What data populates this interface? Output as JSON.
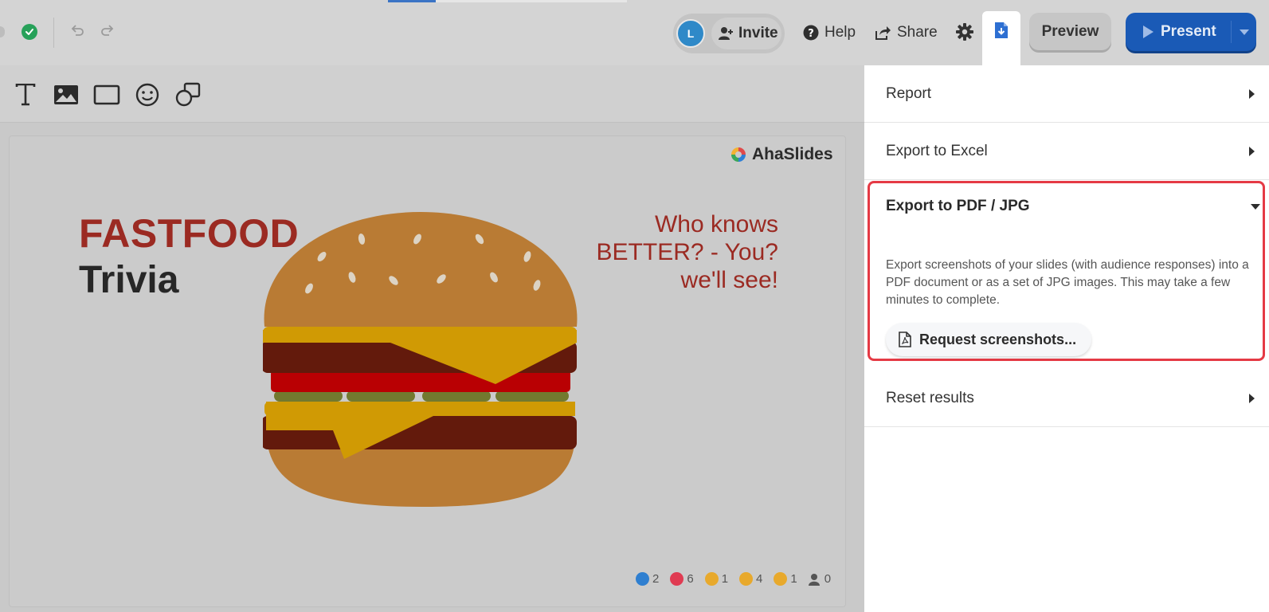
{
  "topbar": {
    "avatar_initial": "L",
    "invite_label": "Invite",
    "help_label": "Help",
    "share_label": "Share",
    "preview_label": "Preview",
    "present_label": "Present",
    "colors": {
      "present_blue": "#1a5ab6",
      "saved_green": "#27a159"
    }
  },
  "toolbar": {
    "tools": [
      "text-icon",
      "image-icon",
      "shape-rectangle-icon",
      "emoji-icon",
      "shapes-icon"
    ]
  },
  "slide": {
    "brand": "AhaSlides",
    "title_line1": "FASTFOOD",
    "title_line2": "Trivia",
    "tagline": [
      "Who knows",
      "BETTER? - You?",
      "we'll see!"
    ],
    "image": "hamburger",
    "reactions": [
      {
        "icon": "thumbs-up-icon",
        "count": "2"
      },
      {
        "icon": "heart-icon",
        "count": "6"
      },
      {
        "icon": "laugh-icon",
        "count": "1"
      },
      {
        "icon": "wow-icon",
        "count": "4"
      },
      {
        "icon": "sad-icon",
        "count": "1"
      },
      {
        "icon": "audience-icon",
        "count": "0"
      }
    ]
  },
  "panel": {
    "report": "Report",
    "export_excel": "Export to Excel",
    "export_pdf": {
      "title": "Export to PDF / JPG",
      "description": "Export screenshots of your slides (with audience responses) into a PDF document or as a set of JPG images. This may take a few minutes to complete.",
      "button": "Request screenshots..."
    },
    "reset": "Reset results",
    "highlight_color": "#e53a45"
  }
}
